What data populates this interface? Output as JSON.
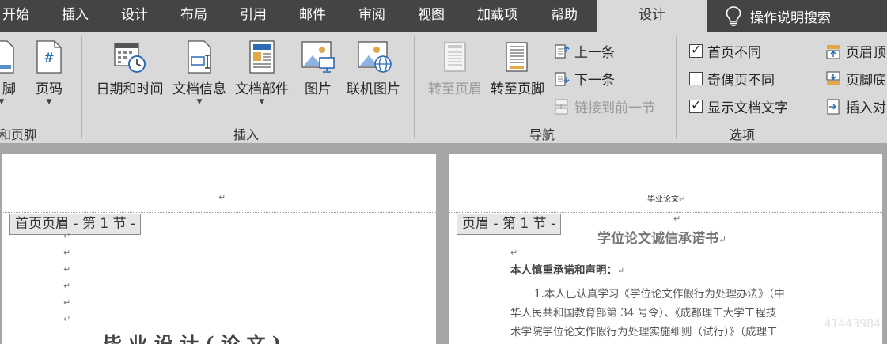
{
  "tabs": [
    {
      "label": "开始"
    },
    {
      "label": "插入"
    },
    {
      "label": "设计"
    },
    {
      "label": "布局"
    },
    {
      "label": "引用"
    },
    {
      "label": "邮件"
    },
    {
      "label": "审阅"
    },
    {
      "label": "视图"
    },
    {
      "label": "加载项"
    },
    {
      "label": "帮助"
    },
    {
      "label": "设计",
      "active": true
    }
  ],
  "search": {
    "label": "操作说明搜索",
    "icon": "lightbulb-icon"
  },
  "ribbon": {
    "header_footer_group": {
      "footer_label": "脚",
      "page_number_label": "页码",
      "group_label": "页眉和页脚",
      "group_label_visible": "和页脚"
    },
    "insert_group": {
      "date_time": "日期和时间",
      "doc_info": "文档信息",
      "doc_parts": "文档部件",
      "picture": "图片",
      "online_picture": "联机图片",
      "group_label": "插入"
    },
    "nav_group": {
      "goto_header": "转至页眉",
      "goto_footer": "转至页脚",
      "previous": "上一条",
      "next": "下一条",
      "link_previous": "链接到前一节",
      "group_label": "导航"
    },
    "options_group": {
      "different_first_page": {
        "label": "首页不同",
        "checked": true
      },
      "different_odd_even": {
        "label": "奇偶页不同",
        "checked": false
      },
      "show_doc_text": {
        "label": "显示文档文字",
        "checked": true
      },
      "group_label": "选项"
    },
    "position_group": {
      "header_top": "页眉顶",
      "footer_bottom": "页脚底",
      "insert_align": "插入对"
    }
  },
  "pages": {
    "left": {
      "header_tag": "首页页眉 - 第 1 节 -",
      "bottom_text": "毕 业 设 计 ( 论 文 )"
    },
    "right": {
      "header_text": "毕业论文",
      "header_tag": "页眉 - 第 1 节 -",
      "title": "学位论文诚信承诺书",
      "statement_heading": "本人慎重承诺和声明：",
      "line1": "1.本人已认真学习《学位论文作假行为处理办法》（中",
      "line2": "华人民共和国教育部第 34 号令）、《成都理工大学工程技",
      "line3": "术学院学位论文作假行为处理实施细则（试行）》（成理工"
    }
  },
  "paragraph_mark": "↵",
  "watermark": "41443984"
}
